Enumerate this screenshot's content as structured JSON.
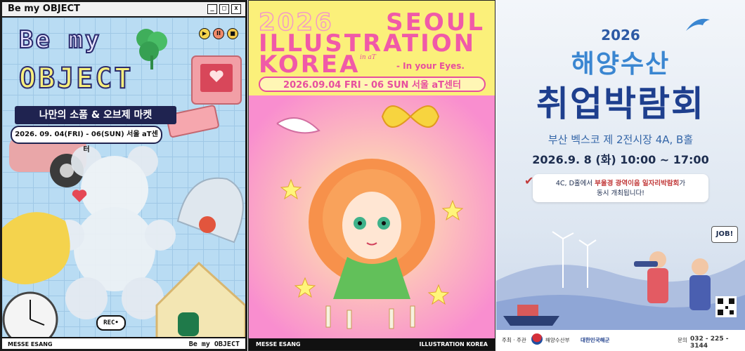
{
  "poster1": {
    "window_title": "Be my OBJECT",
    "headline_line1": "Be my",
    "headline_line2": "OBJECT",
    "subtitle": "나만의 소품 & 오브제 마켓",
    "date": "2026. 09. 04(FRI) - 06(SUN) 서울 aT센터",
    "rec_label": "REC",
    "footer_left": "MESSE ESANG",
    "footer_right": "Be my OBJECT",
    "icons": [
      "minimize-icon",
      "maximize-icon",
      "close-icon",
      "play-icon",
      "pause-icon",
      "stop-icon"
    ]
  },
  "poster2": {
    "year": "2026",
    "line_seoul": "SEOUL",
    "line_illustration": "ILLUSTRATION",
    "line_korea": "KOREA",
    "in_at": "in aT",
    "tagline": "- In your Eyes.",
    "date": "2026.09.04 FRI - 06 SUN 서울 aT센터",
    "footer_left": "MESSE ESANG",
    "footer_right": "ILLUSTRATION KOREA"
  },
  "poster3": {
    "year": "2026",
    "title_line1": "해양수산",
    "title_line2": "취업박람회",
    "venue": "부산 벡스코 제 2전시장 4A, B홀",
    "datetime": "2026.9. 8 (화) 10:00 ~ 17:00",
    "notice_pre": "4C, D홀에서 ",
    "notice_highlight": "부울경 광역이음 일자리박람회",
    "notice_post": "가",
    "notice_line2": "동시 개최됩니다!",
    "job_sign": "JOB!",
    "footer_host": "주최 · 주관",
    "footer_org1": "해양수산부",
    "footer_org2": "대한민국해군",
    "footer_contact_label": "문의",
    "footer_phone": "032 - 225 - 3144"
  },
  "colors": {
    "p1_bg": "#b9dcf3",
    "p2_bg": "#fbf07a",
    "p2_pink": "#f05aa8",
    "p3_navy": "#1e3f8e",
    "p3_blue": "#3a86d1"
  }
}
